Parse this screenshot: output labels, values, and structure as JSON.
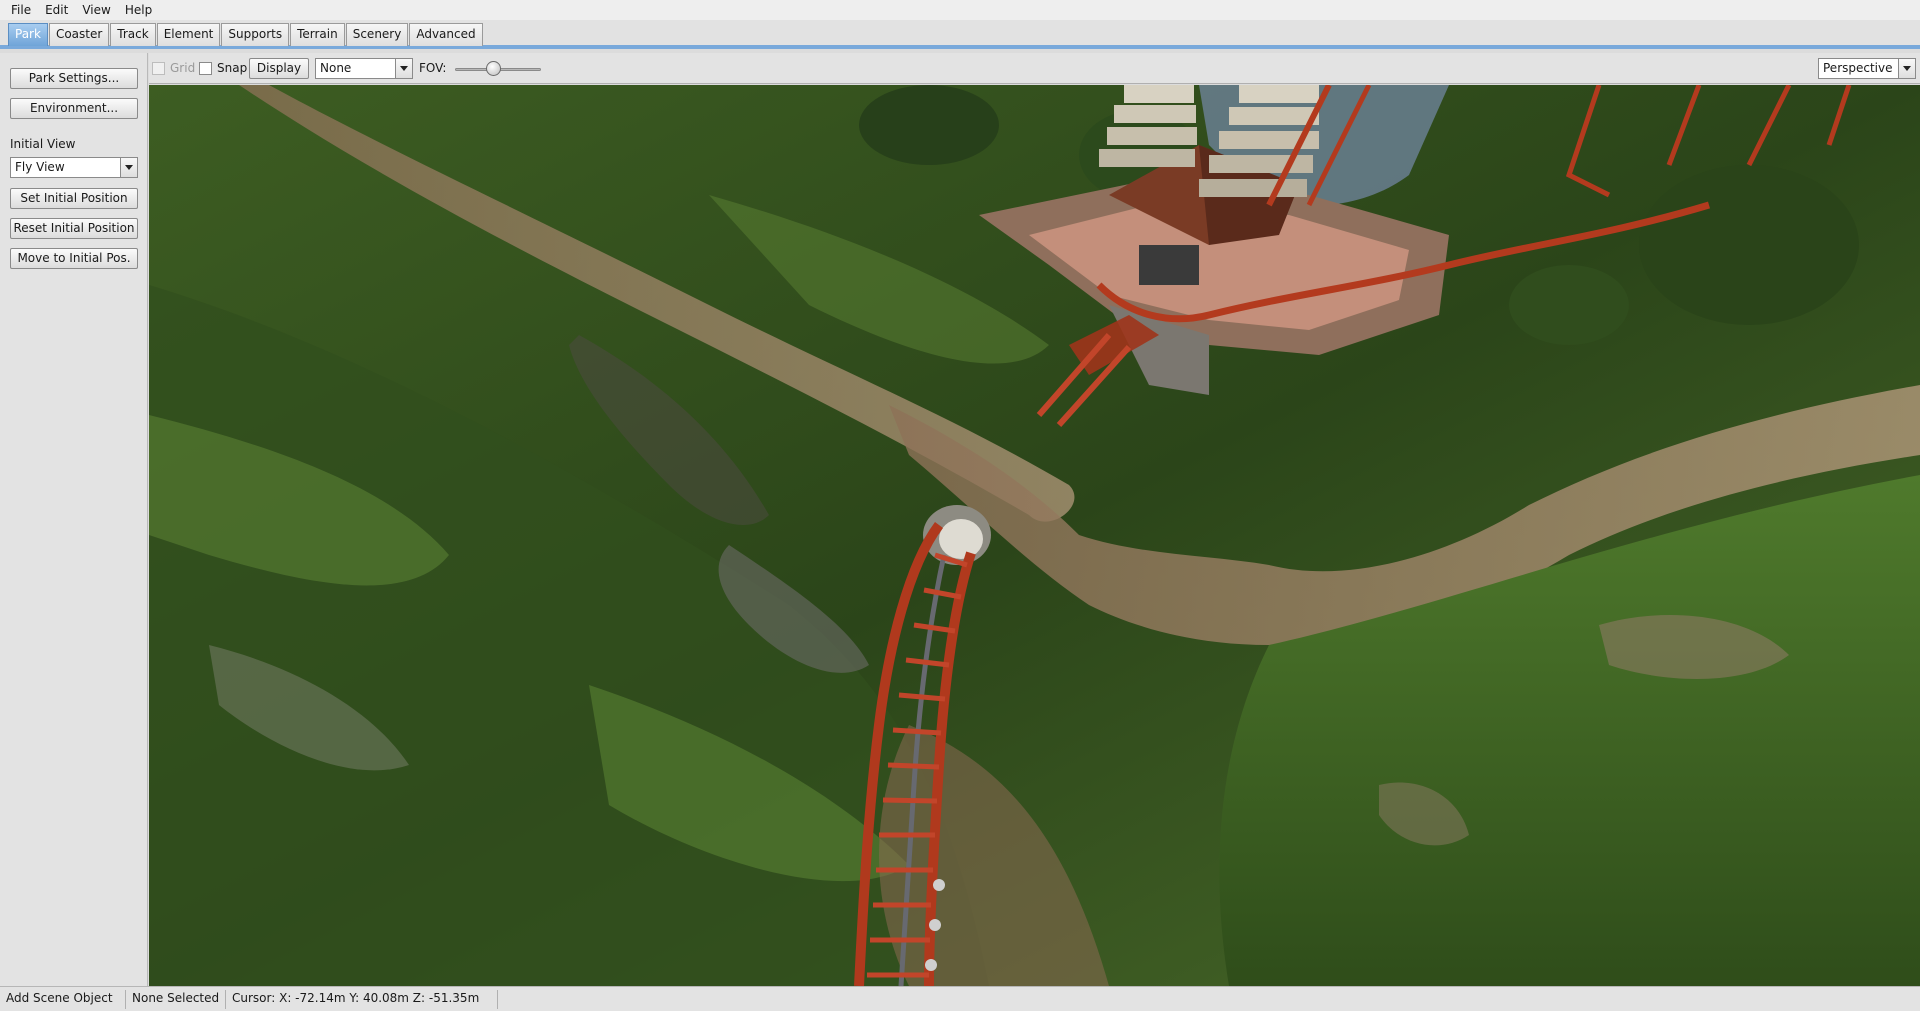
{
  "menu": {
    "items": [
      "File",
      "Edit",
      "View",
      "Help"
    ]
  },
  "tabs": {
    "items": [
      "Park",
      "Coaster",
      "Track",
      "Element",
      "Supports",
      "Terrain",
      "Scenery",
      "Advanced"
    ],
    "active": "Park"
  },
  "left_panel": {
    "park_settings": "Park Settings...",
    "environment": "Environment...",
    "initial_view_label": "Initial View",
    "initial_view_value": "Fly View",
    "set_initial_position": "Set Initial Position",
    "reset_initial_position": "Reset Initial Position",
    "move_to_initial": "Move to Initial Pos."
  },
  "viewport_toolbar": {
    "grid_label": "Grid",
    "snap_label": "Snap",
    "display_button": "Display",
    "display_select_value": "None",
    "fov_label": "FOV:",
    "fov_level": 0.45,
    "projection_value": "Perspective"
  },
  "status_bar": {
    "mode": "Add Scene Object",
    "selection": "None Selected",
    "cursor": "Cursor: X: -72.14m Y: 40.08m Z: -51.35m"
  },
  "colors": {
    "accent_tab": "#6fa4d8",
    "grass_dark": "#2f4a1b",
    "grass_light": "#55762e",
    "dirt": "#9c8264",
    "track_red": "#b33a1e",
    "roof": "#7a3b25",
    "water": "#6b7f95"
  }
}
